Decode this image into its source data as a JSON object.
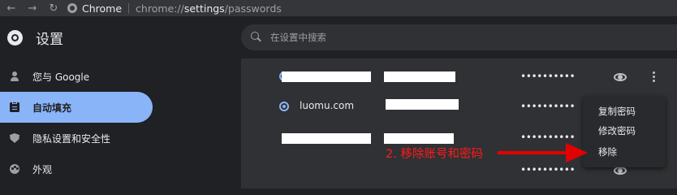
{
  "browser": {
    "back_icon": "←",
    "forward_icon": "→",
    "reload_icon": "↻",
    "site_name": "Chrome",
    "url_prefix": "chrome://",
    "url_bold": "settings",
    "url_suffix": "/passwords"
  },
  "header": {
    "title": "设置",
    "search_placeholder": "在设置中搜索"
  },
  "sidebar": {
    "items": [
      {
        "label": "您与 Google",
        "icon": "person-icon"
      },
      {
        "label": "自动填充",
        "icon": "clipboard-icon",
        "active": true
      },
      {
        "label": "隐私设置和安全性",
        "icon": "shield-icon"
      },
      {
        "label": "外观",
        "icon": "palette-icon"
      }
    ]
  },
  "passwords": {
    "rows": [
      {
        "site": "",
        "password_mask": "••••••••••"
      },
      {
        "site": "luomu.com",
        "password_mask": "••••••••••"
      },
      {
        "site": "",
        "password_mask": "••••••••••"
      },
      {
        "site": "",
        "password_mask": "••••••••••"
      }
    ]
  },
  "context_menu": {
    "items": [
      "复制密码",
      "修改密码",
      "移除"
    ]
  },
  "annotation": {
    "text": "2. 移除账号和密码",
    "color": "#ff1a1a"
  },
  "colors": {
    "accent": "#8ab4f8",
    "background": "#202124",
    "surface": "#303134"
  }
}
